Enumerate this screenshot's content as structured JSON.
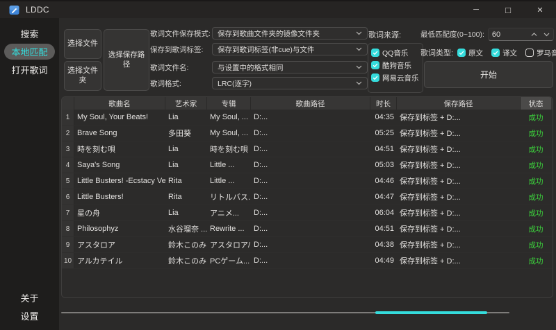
{
  "window": {
    "title": "LDDC",
    "controls": [
      {
        "id": "minimize",
        "glyph": "─"
      },
      {
        "id": "maximize",
        "glyph": "□"
      },
      {
        "id": "close",
        "glyph": "✕"
      }
    ]
  },
  "sidebar": {
    "top_items": [
      {
        "id": "search",
        "label": "搜索",
        "active": false
      },
      {
        "id": "local-match",
        "label": "本地匹配",
        "active": true
      },
      {
        "id": "open-lyrics",
        "label": "打开歌词",
        "active": false
      }
    ],
    "bottom_items": [
      {
        "id": "about",
        "label": "关于",
        "active": false
      },
      {
        "id": "settings",
        "label": "设置",
        "active": false
      }
    ]
  },
  "toolbar": {
    "select_file_label": "选择文件",
    "select_folder_label": "选择文件夹",
    "select_save_path_label": "选择保存路径",
    "fields": [
      {
        "id": "save-mode",
        "label": "歌词文件保存模式:",
        "value": "保存到歌曲文件夹的镜像文件夹"
      },
      {
        "id": "tag-save",
        "label": "保存到歌词标签:",
        "value": "保存到歌词标签(非cue)与文件"
      },
      {
        "id": "filename",
        "label": "歌词文件名:",
        "value": "与设置中的格式相同"
      },
      {
        "id": "format",
        "label": "歌词格式:",
        "value": "LRC(逐字)"
      }
    ],
    "source": {
      "label": "歌词来源:",
      "options": [
        {
          "id": "qq-music",
          "label": "QQ音乐",
          "checked": true
        },
        {
          "id": "kugou-music",
          "label": "酷狗音乐",
          "checked": true
        },
        {
          "id": "netease-music",
          "label": "网易云音乐",
          "checked": true
        }
      ]
    },
    "min_match": {
      "label": "最低匹配度(0~100):",
      "value": "60"
    },
    "lyric_type": {
      "label": "歌词类型:",
      "options": [
        {
          "id": "original",
          "label": "原文",
          "checked": true
        },
        {
          "id": "translated",
          "label": "译文",
          "checked": true
        },
        {
          "id": "romaji",
          "label": "罗马音",
          "checked": false
        }
      ]
    },
    "start_label": "开始"
  },
  "table": {
    "columns": [
      "歌曲名",
      "艺术家",
      "专辑",
      "歌曲路径",
      "时长",
      "保存路径",
      "状态"
    ],
    "rows": [
      {
        "num": "1",
        "song": "My Soul, Your Beats!",
        "artist": "Lia",
        "album": "My Soul, ...",
        "path": "D:...",
        "duration": "04:35",
        "save_path": "保存到标签 + D:...",
        "status": "成功"
      },
      {
        "num": "2",
        "song": "Brave Song",
        "artist": "多田葵",
        "album": "My Soul, ...",
        "path": "D:...",
        "duration": "05:25",
        "save_path": "保存到标签 + D:...",
        "status": "成功"
      },
      {
        "num": "3",
        "song": "時を刻む唄",
        "artist": "Lia",
        "album": "時を刻む唄 ...",
        "path": "D:...",
        "duration": "04:51",
        "save_path": "保存到标签 + D:...",
        "status": "成功"
      },
      {
        "num": "4",
        "song": "Saya's Song",
        "artist": "Lia",
        "album": "Little ...",
        "path": "D:...",
        "duration": "05:03",
        "save_path": "保存到标签 + D:...",
        "status": "成功"
      },
      {
        "num": "5",
        "song": "Little Busters! -Ecstacy Ver.-",
        "artist": "Rita",
        "album": "Little ...",
        "path": "D:...",
        "duration": "04:46",
        "save_path": "保存到标签 + D:...",
        "status": "成功"
      },
      {
        "num": "6",
        "song": "Little Busters!",
        "artist": "Rita",
        "album": "リトルバス...",
        "path": "D:...",
        "duration": "04:47",
        "save_path": "保存到标签 + D:...",
        "status": "成功"
      },
      {
        "num": "7",
        "song": "星の舟",
        "artist": "Lia",
        "album": "アニメ...",
        "path": "D:...",
        "duration": "06:04",
        "save_path": "保存到标签 + D:...",
        "status": "成功"
      },
      {
        "num": "8",
        "song": "Philosophyz",
        "artist": "水谷瑠奈 ...",
        "album": "Rewrite ...",
        "path": "D:...",
        "duration": "04:51",
        "save_path": "保存到标签 + D:...",
        "status": "成功"
      },
      {
        "num": "9",
        "song": "アスタロア",
        "artist": "鈴木このみ",
        "album": "アスタロア/...",
        "path": "D:...",
        "duration": "04:38",
        "save_path": "保存到标签 + D:...",
        "status": "成功"
      },
      {
        "num": "10",
        "song": "アルカテイル",
        "artist": "鈴木このみ",
        "album": "PCゲーム...",
        "path": "D:...",
        "duration": "04:49",
        "save_path": "保存到标签 + D:...",
        "status": "成功"
      }
    ]
  },
  "progress": {
    "segment_start_pct": 70,
    "segment_width_pct": 25
  },
  "colors": {
    "accent": "#35dcdc",
    "success": "#3cd23c",
    "active_pill_bg": "#5c5b5a"
  }
}
